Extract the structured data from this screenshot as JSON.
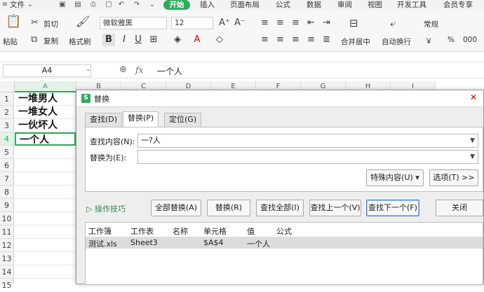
{
  "menubar": {
    "file": "文件",
    "tabs": [
      "开始",
      "插入",
      "页面布局",
      "公式",
      "数据",
      "审阅",
      "视图",
      "开发工具",
      "会员专享"
    ]
  },
  "ribbon": {
    "paste": "粘贴",
    "cut": "剪切",
    "copy": "复制",
    "format_painter": "格式刷",
    "font_name": "微软雅黑",
    "font_size": "12",
    "merge_center": "合并居中",
    "wrap_text": "自动换行",
    "number_format": "常规",
    "currency_symbol": "￥",
    "percent_symbol": "%",
    "thousands": "000"
  },
  "formula_bar": {
    "cell_ref": "A4",
    "fx": "fx",
    "content": "一个人"
  },
  "sheet": {
    "columns": [
      "A",
      "B",
      "C",
      "D",
      "E",
      "F",
      "G",
      "H",
      "I"
    ],
    "rows": [
      "1",
      "2",
      "3",
      "4",
      "5",
      "6",
      "7",
      "8",
      "9",
      "10",
      "11",
      "12",
      "13",
      "14",
      "15"
    ],
    "cells": [
      "一堆男人",
      "一堆女人",
      "一伙坏人",
      "一个人"
    ]
  },
  "dialog": {
    "title": "替换",
    "logo": "S",
    "tabs": [
      "查找(D)",
      "替换(P)",
      "定位(G)"
    ],
    "find_label": "查找内容(N):",
    "find_value": "一?人",
    "replace_label": "替换为(E):",
    "replace_value": "",
    "special_button": "特殊内容(U) ▾",
    "options_button": "选项(T) >>",
    "tips": "操作技巧",
    "buttons": [
      "全部替换(A)",
      "替换(R)",
      "查找全部(I)",
      "查找上一个(V)",
      "查找下一个(F)",
      "关闭"
    ],
    "result_headers": [
      "工作簿",
      "工作表",
      "名称",
      "单元格",
      "值",
      "公式"
    ],
    "result_row": [
      "测试.xls",
      "Sheet3",
      "",
      "$A$4",
      "一个人",
      ""
    ]
  },
  "colors": {
    "accent": "#2dab5e",
    "selection": "#2dab5e"
  }
}
